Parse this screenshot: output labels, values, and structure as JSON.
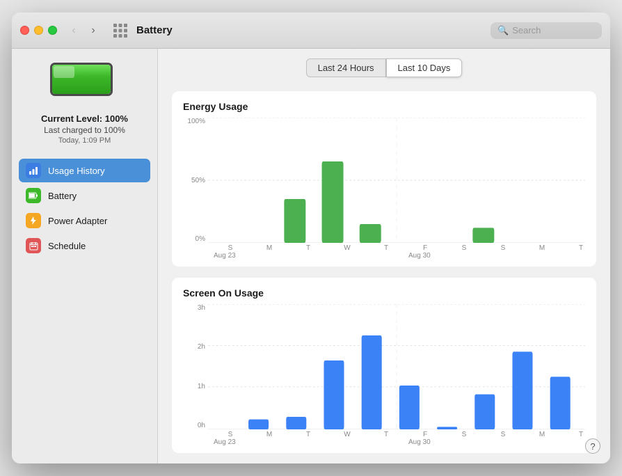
{
  "window": {
    "title": "Battery"
  },
  "titlebar": {
    "back_label": "‹",
    "forward_label": "›",
    "search_placeholder": "Search"
  },
  "battery": {
    "level_text": "Current Level: 100%",
    "charged_text": "Last charged to 100%",
    "time_text": "Today, 1:09 PM",
    "fill_percent": 100
  },
  "sidebar": {
    "items": [
      {
        "id": "usage-history",
        "label": "Usage History",
        "icon": "usage",
        "active": true
      },
      {
        "id": "battery",
        "label": "Battery",
        "icon": "battery",
        "active": false
      },
      {
        "id": "power-adapter",
        "label": "Power Adapter",
        "icon": "power",
        "active": false
      },
      {
        "id": "schedule",
        "label": "Schedule",
        "icon": "schedule",
        "active": false
      }
    ]
  },
  "tabs": [
    {
      "id": "last-24h",
      "label": "Last 24 Hours",
      "active": false
    },
    {
      "id": "last-10d",
      "label": "Last 10 Days",
      "active": true
    }
  ],
  "energy_chart": {
    "title": "Energy Usage",
    "y_labels": [
      "100%",
      "50%",
      "0%"
    ],
    "days": [
      "S",
      "M",
      "T",
      "W",
      "T",
      "F",
      "S",
      "S",
      "M",
      "T"
    ],
    "week_labels": [
      {
        "pos": 0,
        "label": "Aug 23"
      },
      {
        "pos": 7,
        "label": "Aug 30"
      }
    ],
    "bars": [
      0,
      0,
      0,
      35,
      65,
      15,
      0,
      0,
      12,
      0
    ]
  },
  "screen_chart": {
    "title": "Screen On Usage",
    "y_labels": [
      "3h",
      "2h",
      "1h",
      "0h"
    ],
    "days": [
      "S",
      "M",
      "T",
      "W",
      "T",
      "F",
      "S",
      "S",
      "M",
      "T"
    ],
    "week_labels": [
      {
        "pos": 0,
        "label": "Aug 23"
      },
      {
        "pos": 7,
        "label": "Aug 30"
      }
    ],
    "bars": [
      0,
      8,
      10,
      55,
      75,
      35,
      2,
      28,
      62,
      42
    ]
  },
  "help": {
    "label": "?"
  }
}
